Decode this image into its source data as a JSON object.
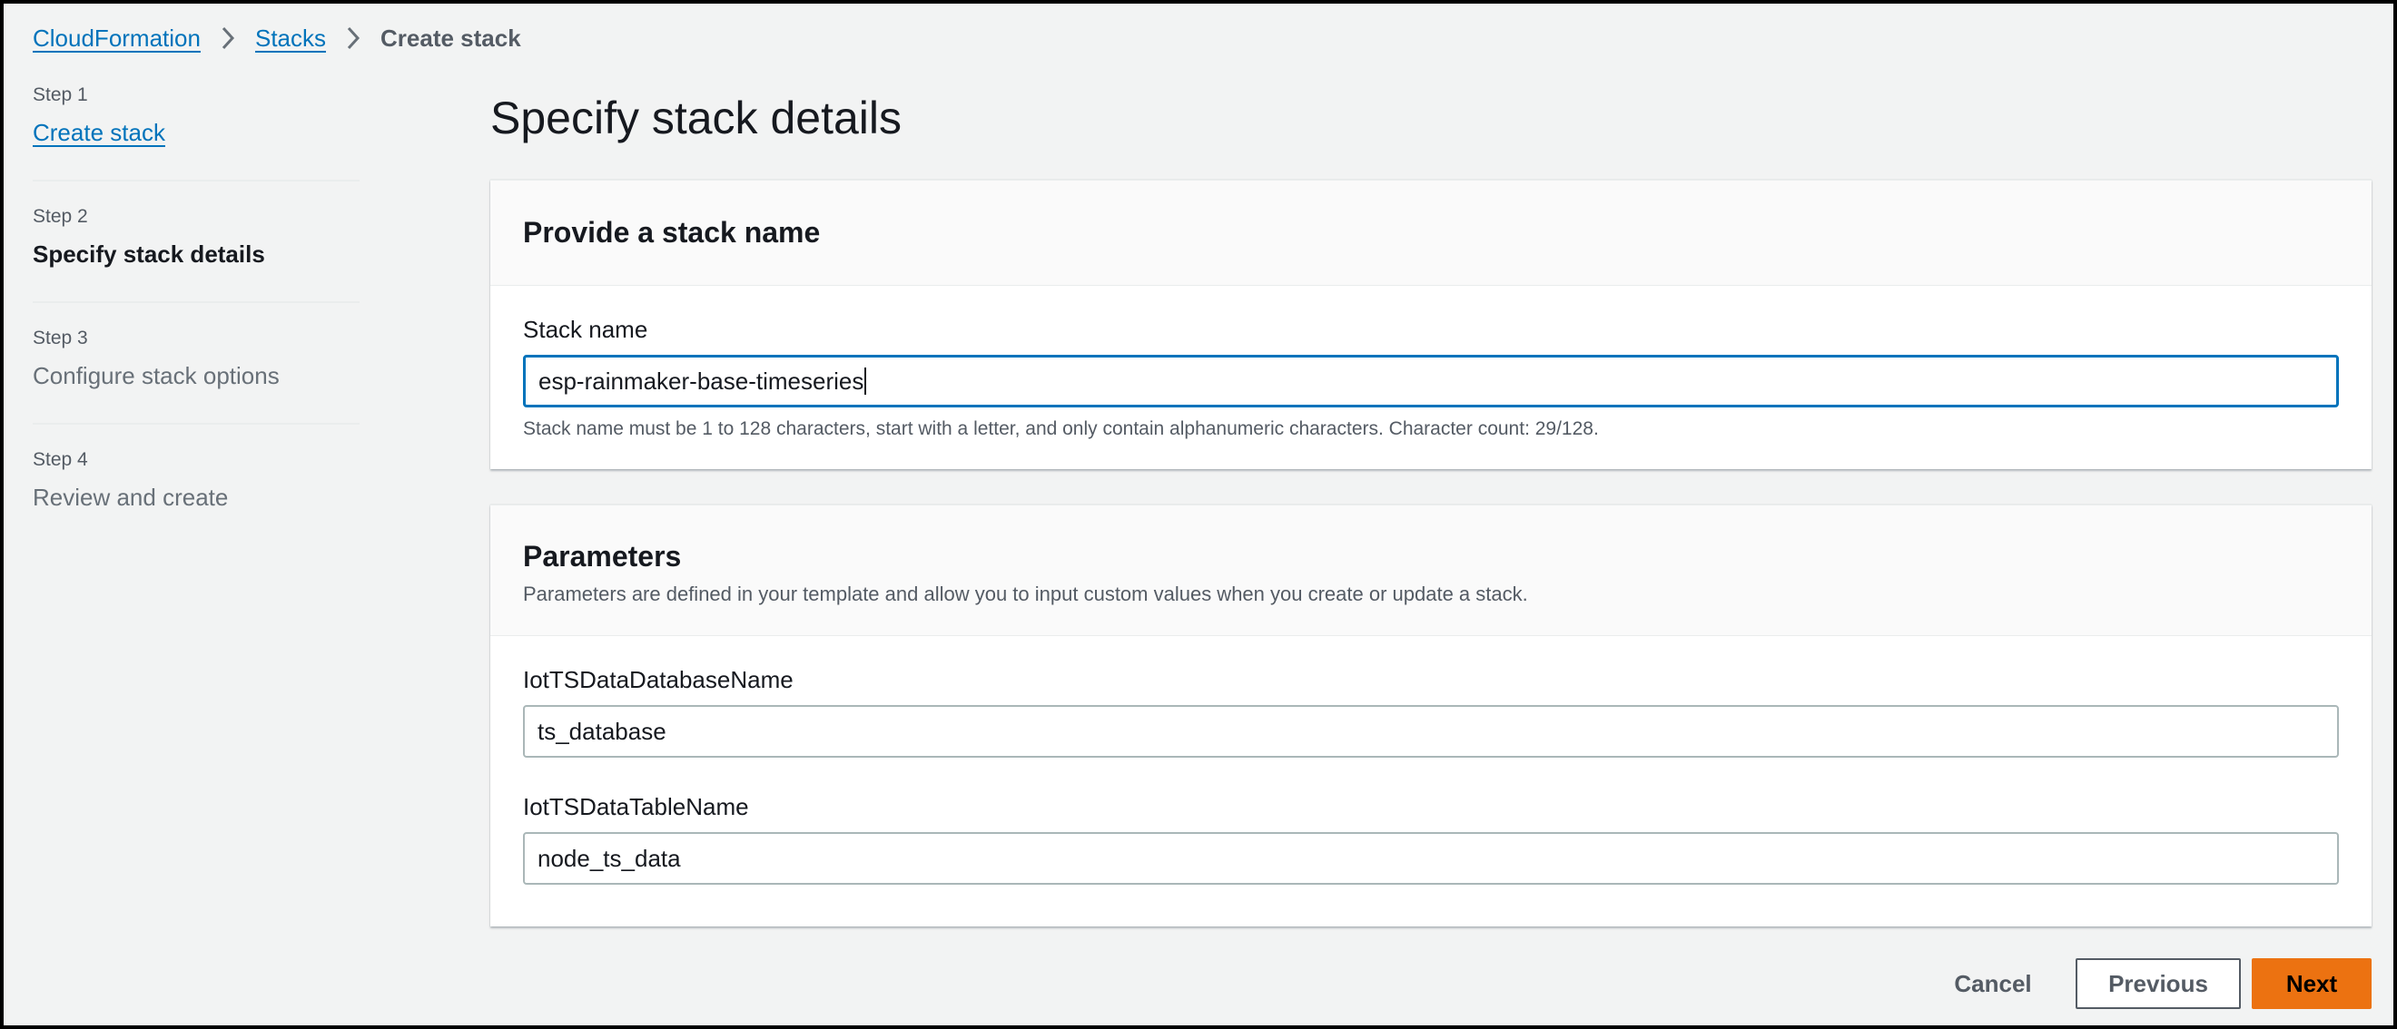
{
  "breadcrumb": {
    "items": [
      "CloudFormation",
      "Stacks"
    ],
    "current": "Create stack"
  },
  "steps": [
    {
      "num": "Step 1",
      "title": "Create stack"
    },
    {
      "num": "Step 2",
      "title": "Specify stack details"
    },
    {
      "num": "Step 3",
      "title": "Configure stack options"
    },
    {
      "num": "Step 4",
      "title": "Review and create"
    }
  ],
  "page": {
    "title": "Specify stack details"
  },
  "stack_name_panel": {
    "title": "Provide a stack name",
    "label": "Stack name",
    "value": "esp-rainmaker-base-timeseries",
    "help": "Stack name must be 1 to 128 characters, start with a letter, and only contain alphanumeric characters. Character count: 29/128."
  },
  "parameters_panel": {
    "title": "Parameters",
    "description": "Parameters are defined in your template and allow you to input custom values when you create or update a stack.",
    "fields": [
      {
        "label": "IotTSDataDatabaseName",
        "value": "ts_database"
      },
      {
        "label": "IotTSDataTableName",
        "value": "node_ts_data"
      }
    ]
  },
  "footer": {
    "cancel": "Cancel",
    "previous": "Previous",
    "next": "Next"
  },
  "colors": {
    "link": "#0073bb",
    "primary_button": "#ec7211",
    "focus_border": "#0073bb"
  }
}
